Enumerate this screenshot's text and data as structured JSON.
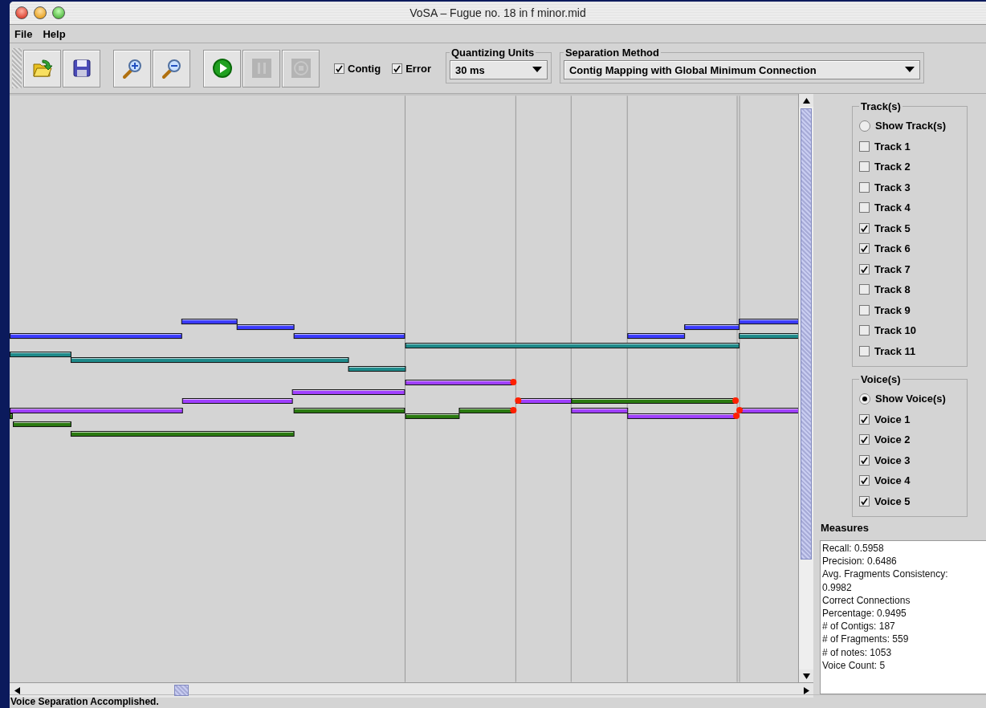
{
  "window": {
    "title": "VoSA – Fugue no. 18 in f minor.mid"
  },
  "menu": [
    "File",
    "Help"
  ],
  "toolbar": {
    "buttons": [
      {
        "kind": "open",
        "disabled": false
      },
      {
        "kind": "save",
        "disabled": false
      },
      {
        "kind": "zoom-in",
        "disabled": false
      },
      {
        "kind": "zoom-out",
        "disabled": false
      },
      {
        "kind": "play",
        "disabled": false
      },
      {
        "kind": "pause",
        "disabled": true
      },
      {
        "kind": "stop",
        "disabled": true
      }
    ],
    "checkboxes": [
      {
        "label": "Contig",
        "checked": true
      },
      {
        "label": "Error",
        "checked": true
      }
    ]
  },
  "quantizing_units": {
    "label": "Quantizing Units",
    "value": "30 ms"
  },
  "separation_method": {
    "label": "Separation Method",
    "value": "Contig Mapping with Global Minimum Connection"
  },
  "tracks": {
    "title": "Track(s)",
    "show": {
      "label": "Show Track(s)",
      "selected": false
    },
    "items": [
      {
        "label": "Track 1",
        "checked": false
      },
      {
        "label": "Track 2",
        "checked": false
      },
      {
        "label": "Track 3",
        "checked": false
      },
      {
        "label": "Track 4",
        "checked": false
      },
      {
        "label": "Track 5",
        "checked": true
      },
      {
        "label": "Track 6",
        "checked": true
      },
      {
        "label": "Track 7",
        "checked": true
      },
      {
        "label": "Track 8",
        "checked": false
      },
      {
        "label": "Track 9",
        "checked": false
      },
      {
        "label": "Track 10",
        "checked": false
      },
      {
        "label": "Track 11",
        "checked": false
      }
    ]
  },
  "voices": {
    "title": "Voice(s)",
    "show": {
      "label": "Show Voice(s)",
      "selected": true
    },
    "items": [
      {
        "label": "Voice 1",
        "checked": true
      },
      {
        "label": "Voice 2",
        "checked": true
      },
      {
        "label": "Voice 3",
        "checked": true
      },
      {
        "label": "Voice 4",
        "checked": true
      },
      {
        "label": "Voice 5",
        "checked": true
      }
    ]
  },
  "measures": {
    "title": "Measures",
    "lines": [
      "Recall: 0.5958",
      "Precision: 0.6486",
      "Avg. Fragments Consistency:",
      "0.9982",
      "Correct Connections",
      "Percentage: 0.9495",
      "# of Contigs: 187",
      "# of Fragments: 559",
      "# of notes: 1053",
      "Voice Count: 5"
    ]
  },
  "status_bar": "Voice Separation Accomplished."
}
